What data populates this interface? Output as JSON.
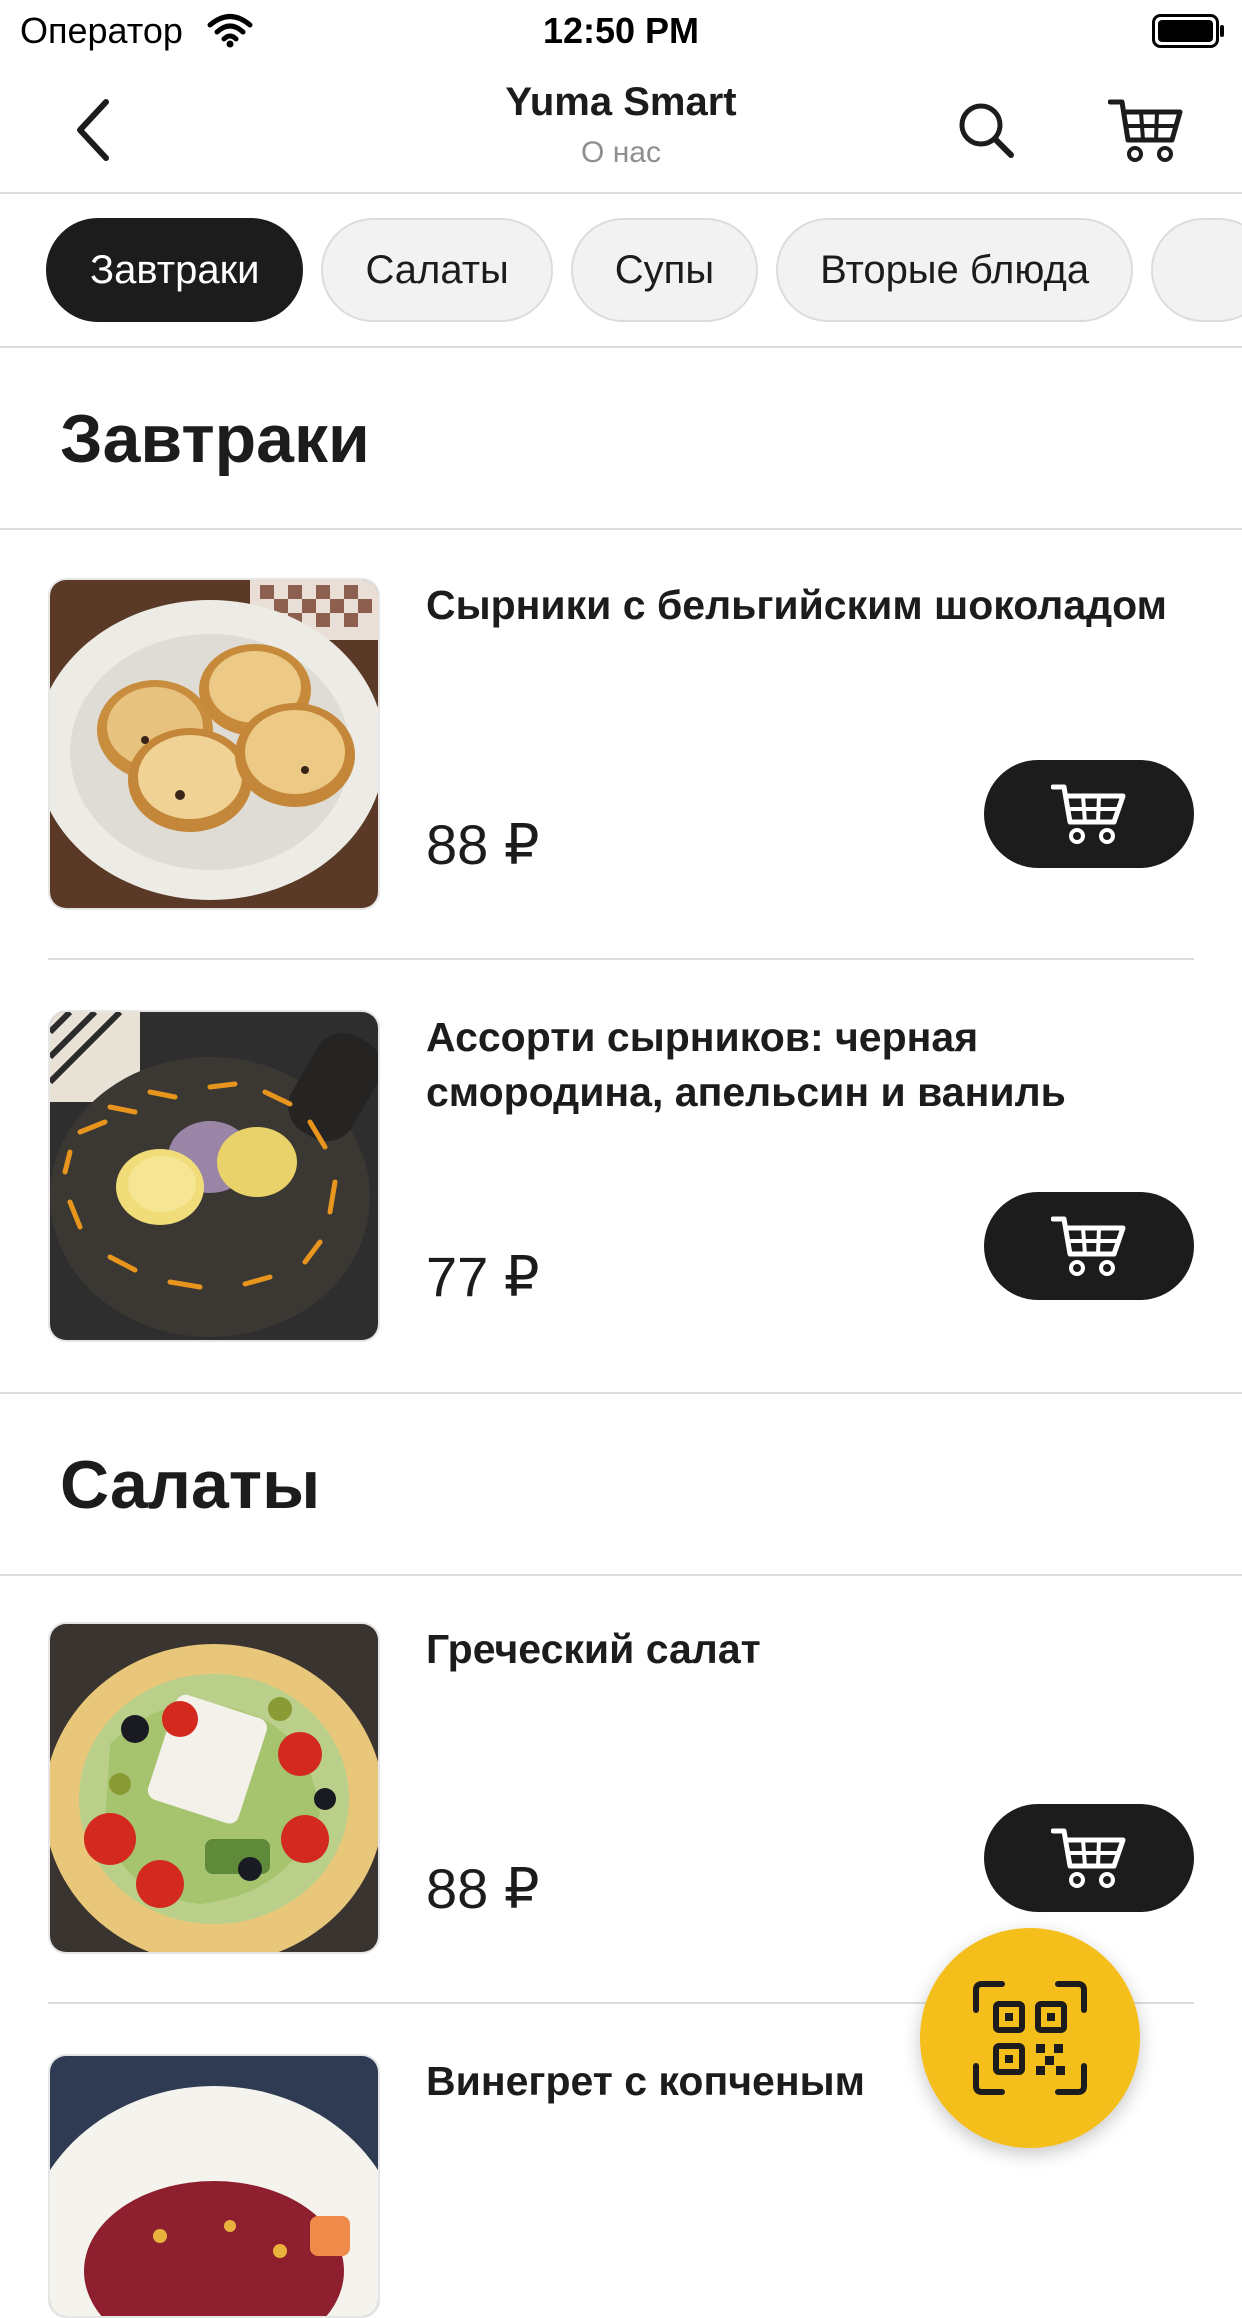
{
  "status_bar": {
    "carrier": "Оператор",
    "time": "12:50 PM"
  },
  "nav": {
    "title": "Yuma Smart",
    "subtitle": "О нас",
    "icons": [
      "chevron-left-icon",
      "search-icon",
      "cart-icon"
    ]
  },
  "categories": [
    {
      "label": "Завтраки",
      "active": true
    },
    {
      "label": "Салаты",
      "active": false
    },
    {
      "label": "Супы",
      "active": false
    },
    {
      "label": "Вторые блюда",
      "active": false
    },
    {
      "label": "",
      "active": false
    }
  ],
  "sections": [
    {
      "title": "Завтраки",
      "items": [
        {
          "name": "Сырники с бельгийским шоколадом",
          "price": "88 ₽"
        },
        {
          "name": "Ассорти сырников: черная смородина, апельсин и ваниль",
          "price": "77 ₽"
        }
      ]
    },
    {
      "title": "Салаты",
      "items": [
        {
          "name": "Греческий салат",
          "price": "88 ₽"
        },
        {
          "name": "Винегрет с копченым",
          "price": ""
        }
      ]
    }
  ],
  "colors": {
    "accent": "#f5bf1b",
    "dark": "#1c1c1c",
    "divider": "#dcdcdc",
    "muted": "#8e8e93"
  },
  "fab_icon": "qr-code-icon"
}
